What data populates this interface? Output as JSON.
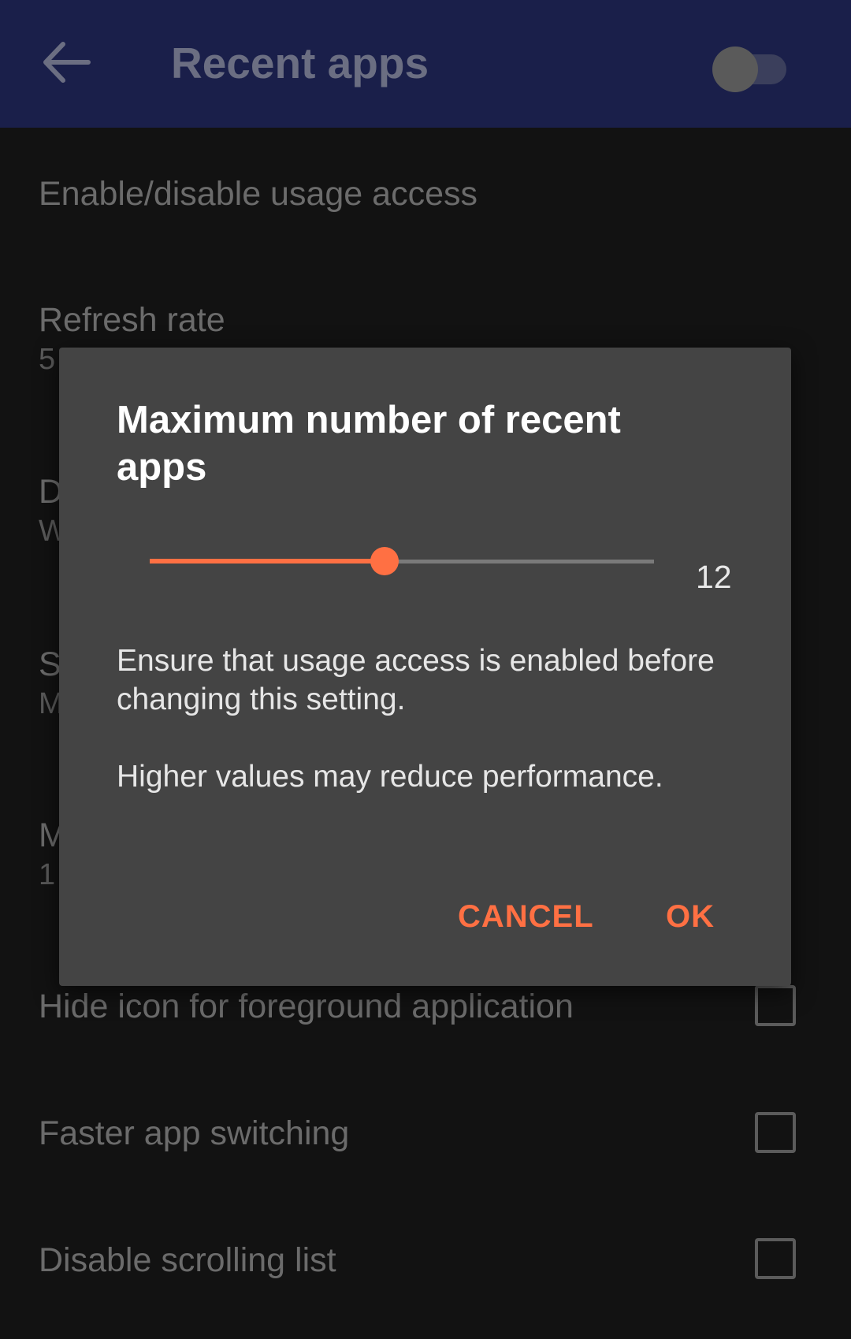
{
  "app_bar": {
    "title": "Recent apps",
    "back_icon": "arrow-left-icon",
    "toggle_state": "off"
  },
  "settings": {
    "usage_access": {
      "title": "Enable/disable usage access"
    },
    "refresh_rate": {
      "title": "Refresh rate",
      "summary": "5"
    },
    "row3": {
      "title": "D",
      "summary": "W"
    },
    "row4": {
      "title": "S",
      "summary": "M"
    },
    "row5": {
      "title": "M",
      "summary": "1"
    },
    "hide_icon": {
      "title": "Hide icon for foreground application",
      "checked": false
    },
    "faster_switching": {
      "title": "Faster app switching",
      "checked": false
    },
    "disable_scrolling": {
      "title": "Disable scrolling list",
      "checked": false
    }
  },
  "dialog": {
    "title": "Maximum number of recent apps",
    "slider": {
      "value": "12",
      "fraction": 0.465
    },
    "message_1": "Ensure that usage access is enabled before changing this setting.",
    "message_2": "Higher values may reduce performance.",
    "cancel_label": "CANCEL",
    "ok_label": "OK"
  },
  "colors": {
    "accent": "#ff7043",
    "app_bar": "#1a1f4a",
    "dialog_bg": "#444444",
    "background": "#121212"
  }
}
